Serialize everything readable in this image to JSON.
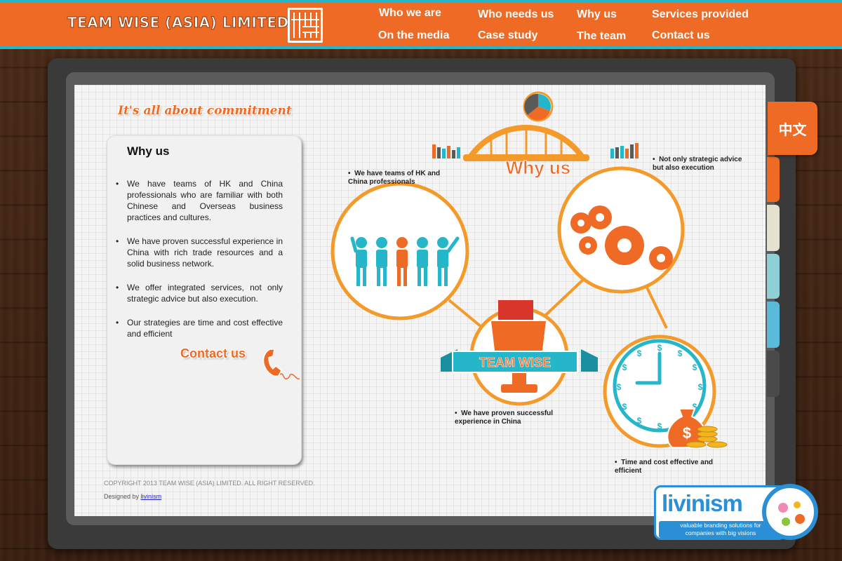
{
  "brand": {
    "name": "TEAM WISE (ASIA) LIMITED"
  },
  "nav": {
    "items": [
      {
        "label": "Who we are"
      },
      {
        "label": "Who needs us"
      },
      {
        "label": "Why us",
        "active": true
      },
      {
        "label": "Services provided"
      },
      {
        "label": "On the media"
      },
      {
        "label": "Case study"
      },
      {
        "label": "The team"
      },
      {
        "label": "Contact us"
      }
    ]
  },
  "lang_tab": {
    "label": "中文"
  },
  "tagline": "It's all about commitment",
  "panel": {
    "title": "Why us",
    "points": [
      "We have teams of HK and China professionals who are familiar with both Chinese and Overseas business practices and cultures.",
      "We have proven successful experience in China with rich trade resources and a solid business network.",
      "We offer integrated services, not only strategic advice but also execution.",
      "Our strategies are time and cost effective and efficient"
    ],
    "cta": "Contact us"
  },
  "infographic": {
    "heading": "Why us",
    "emblem": "TEAM WISE",
    "notes": [
      "We have teams of HK and China professionals",
      "Not only strategic advice but also execution",
      "We have proven successful experience in China",
      "Time and cost effective and efficient"
    ],
    "currency_symbol": "$"
  },
  "footer": {
    "copyright": "COPYRIGHT 2013 TEAM WISE (ASIA) LIMITED. ALL RIGHT RESERVED.",
    "designed_prefix": "Designed by",
    "designed_link": "livinism"
  },
  "badge": {
    "name": "livinism",
    "tagline_line1": "valuable branding solutions for",
    "tagline_line2": "companies with big visions"
  },
  "colors": {
    "orange": "#ef6a24",
    "teal": "#25b6c9",
    "brand_blue": "#2a8fd4",
    "tab_colors": [
      "#ef6a24",
      "#ef8a2c",
      "#e4e2cf",
      "#8fd0d6",
      "#5bbad9",
      "#4a4a4a"
    ]
  }
}
